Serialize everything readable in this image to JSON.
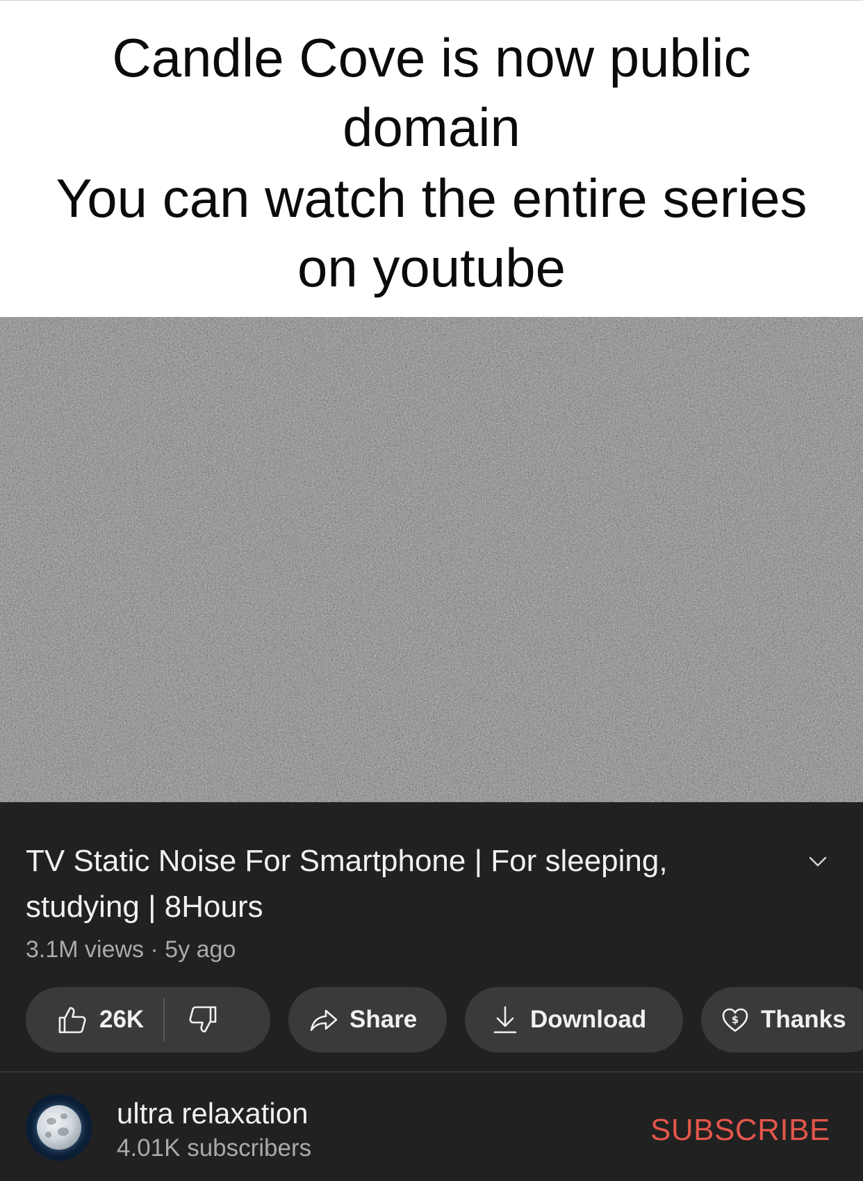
{
  "caption": {
    "lines": [
      "Candle Cove is now public",
      "domain",
      "You can watch the entire series",
      "on youtube"
    ]
  },
  "video": {
    "thumbnail": "tv-static-noise",
    "title": "TV Static Noise For Smartphone | For sleeping, studying | 8Hours",
    "views": "3.1M views",
    "age": "5y ago",
    "meta_separator": "·"
  },
  "actions": {
    "like_count": "26K",
    "share_label": "Share",
    "download_label": "Download",
    "thanks_label": "Thanks"
  },
  "channel": {
    "name": "ultra relaxation",
    "subscribers": "4.01K subscribers",
    "subscribe_label": "SUBSCRIBE",
    "avatar": "full-moon"
  },
  "colors": {
    "panel_bg": "#212121",
    "pill_bg": "#3a3a3a",
    "subscribe": "#e3564b",
    "text_primary": "#f1f1f1",
    "text_secondary": "#aaaaaa"
  },
  "icons": {
    "expand": "chevron-down-icon",
    "like": "thumbs-up-icon",
    "dislike": "thumbs-down-icon",
    "share": "share-arrow-icon",
    "download": "download-icon",
    "thanks": "heart-dollar-icon"
  }
}
